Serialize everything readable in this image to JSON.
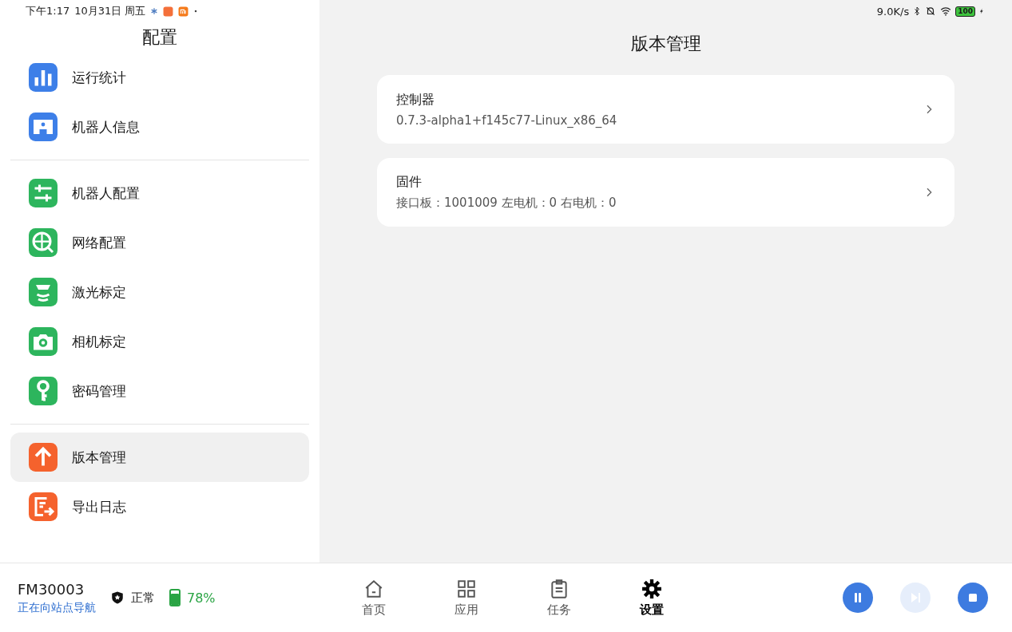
{
  "status_bar": {
    "time": "下午1:17",
    "date": "10月31日 周五",
    "speed": "9.0K/s",
    "battery": "100"
  },
  "sidebar": {
    "title": "配置",
    "groups": [
      [
        {
          "label": "运行统计",
          "kind": "chart",
          "color": "#3d7fe8",
          "selected": false
        },
        {
          "label": "机器人信息",
          "kind": "robot",
          "color": "#3d7fe8",
          "selected": false
        }
      ],
      [
        {
          "label": "机器人配置",
          "kind": "sliders",
          "color": "#2db55d",
          "selected": false
        },
        {
          "label": "网络配置",
          "kind": "globe",
          "color": "#2db55d",
          "selected": false
        },
        {
          "label": "激光标定",
          "kind": "laser",
          "color": "#2db55d",
          "selected": false
        },
        {
          "label": "相机标定",
          "kind": "camera",
          "color": "#2db55d",
          "selected": false
        },
        {
          "label": "密码管理",
          "kind": "key",
          "color": "#2db55d",
          "selected": false
        }
      ],
      [
        {
          "label": "版本管理",
          "kind": "upload",
          "color": "#f5622d",
          "selected": true
        },
        {
          "label": "导出日志",
          "kind": "export",
          "color": "#f5622d",
          "selected": false
        }
      ]
    ]
  },
  "main": {
    "title": "版本管理",
    "cards": [
      {
        "title": "控制器",
        "detail": "0.7.3-alpha1+f145c77-Linux_x86_64"
      },
      {
        "title": "固件",
        "detail": "接口板：1001009 左电机：0 右电机：0"
      }
    ]
  },
  "footer": {
    "robot_id": "FM30003",
    "task": "正在向站点导航",
    "safety": "正常",
    "battery": {
      "level": 0.78,
      "reading": "78%"
    },
    "nav": [
      {
        "label": "首页",
        "kind": "home",
        "selected": false
      },
      {
        "label": "应用",
        "kind": "grid",
        "selected": false
      },
      {
        "label": "任务",
        "kind": "clipboard",
        "selected": false
      },
      {
        "label": "设置",
        "kind": "gear",
        "selected": true
      }
    ],
    "controls": [
      {
        "kind": "pause",
        "disabled": false
      },
      {
        "kind": "skip",
        "disabled": true
      },
      {
        "kind": "stop",
        "disabled": false
      }
    ]
  }
}
